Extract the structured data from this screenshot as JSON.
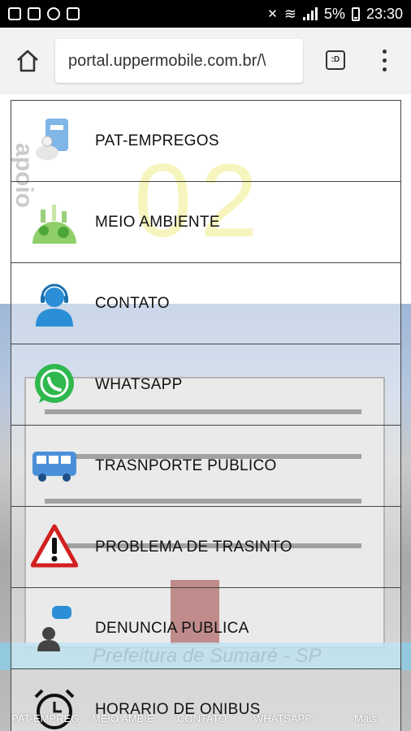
{
  "status_bar": {
    "battery": "5%",
    "time": "23:30"
  },
  "browser": {
    "url": "portal.uppermobile.com.br/\\",
    "tab_count": ":D"
  },
  "page": {
    "watermark": "02",
    "apoio": "apoio",
    "prefeitura": "Prefeitura de Sumaré - SP",
    "menu_items": [
      {
        "label": "PAT-EMPREGOS",
        "icon": "briefcase-icon"
      },
      {
        "label": "MEIO AMBIENTE",
        "icon": "globe-environment-icon"
      },
      {
        "label": "CONTATO",
        "icon": "headset-person-icon"
      },
      {
        "label": "WHATSAPP",
        "icon": "whatsapp-icon"
      },
      {
        "label": "TRASNPORTE PUBLICO",
        "icon": "bus-icon"
      },
      {
        "label": "PROBLEMA DE TRASINTO",
        "icon": "warning-triangle-icon"
      },
      {
        "label": "DENUNCIA PUBLICA",
        "icon": "speech-person-icon"
      },
      {
        "label": "HORARIO DE ONIBUS",
        "icon": "alarm-clock-icon"
      }
    ],
    "bottom_nav": [
      "PAT-EMPREG",
      "MEIO AMBIE",
      "CONTATO",
      "WHATSAPP",
      "Mais"
    ]
  }
}
